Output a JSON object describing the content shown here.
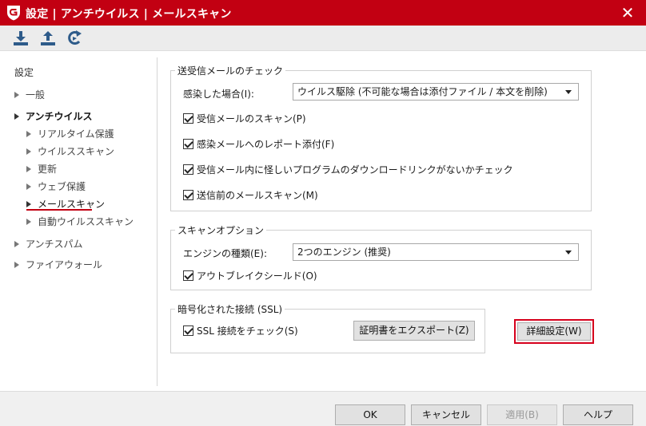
{
  "window": {
    "title": "設定 | アンチウイルス | メールスキャン",
    "close_glyph": "✕"
  },
  "toolbar": {
    "icons": [
      "import-icon",
      "export-icon",
      "reset-icon"
    ]
  },
  "sidebar": {
    "header": "設定",
    "items": [
      {
        "label": "一般",
        "level": 1
      },
      {
        "label": "アンチウイルス",
        "level": 1
      },
      {
        "label": "リアルタイム保護",
        "level": 2
      },
      {
        "label": "ウイルススキャン",
        "level": 2
      },
      {
        "label": "更新",
        "level": 2
      },
      {
        "label": "ウェブ保護",
        "level": 2
      },
      {
        "label": "メールスキャン",
        "level": 2,
        "active": true
      },
      {
        "label": "自動ウイルススキャン",
        "level": 2
      },
      {
        "label": "アンチスパム",
        "level": 1
      },
      {
        "label": "ファイアウォール",
        "level": 1
      }
    ]
  },
  "mail_check": {
    "title": "送受信メールのチェック",
    "infected_label": "感染した場合(I):",
    "infected_value": "ウイルス駆除 (不可能な場合は添付ファイル / 本文を削除)",
    "options": [
      "受信メールのスキャン(P)",
      "感染メールへのレポート添付(F)",
      "受信メール内に怪しいプログラムのダウンロードリンクがないかチェック",
      "送信前のメールスキャン(M)"
    ]
  },
  "scan_options": {
    "title": "スキャンオプション",
    "engine_label": "エンジンの種類(E):",
    "engine_value": "2つのエンジン (推奨)",
    "outbreak_label": "アウトブレイクシールド(O)"
  },
  "ssl": {
    "title": "暗号化された接続 (SSL)",
    "check_label": "SSL 接続をチェック(S)",
    "export_button": "証明書をエクスポート(Z)"
  },
  "advanced_button": "詳細設定(W)",
  "footer": {
    "ok": "OK",
    "cancel": "キャンセル",
    "apply": "適用(B)",
    "help": "ヘルプ"
  },
  "colors": {
    "brand_red": "#c20012",
    "highlight_red": "#d6001c"
  }
}
